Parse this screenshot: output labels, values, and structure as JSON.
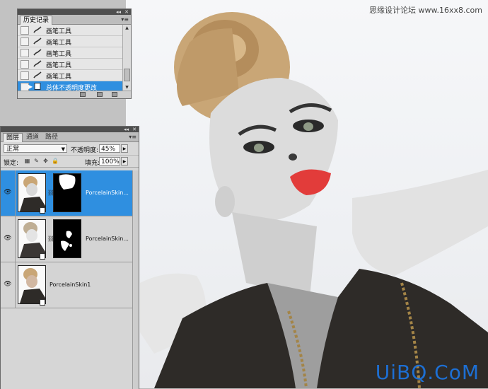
{
  "watermark_top": "思缘设计论坛",
  "watermark_top_site": "www.16xx8.com",
  "watermark_bottom": "UiBQ.CoM",
  "history": {
    "tab_label": "历史记录",
    "items": [
      {
        "label": "画笔工具"
      },
      {
        "label": "画笔工具"
      },
      {
        "label": "画笔工具"
      },
      {
        "label": "画笔工具"
      },
      {
        "label": "画笔工具"
      },
      {
        "label": "总体不透明度更改",
        "selected": true
      }
    ]
  },
  "layers_panel": {
    "tabs": [
      "图层",
      "通道",
      "路径"
    ],
    "blend_mode": "正常",
    "opacity_label": "不透明度:",
    "opacity_value": "45%",
    "lock_label": "锁定:",
    "fill_label": "填充:",
    "fill_value": "100%",
    "layers": [
      {
        "name": "PorcelainSkin...",
        "selected": true,
        "has_mask": true
      },
      {
        "name": "PorcelainSkin...",
        "selected": false,
        "has_mask": true
      },
      {
        "name": "PorcelainSkin1",
        "selected": false,
        "has_mask": false
      }
    ]
  },
  "colors": {
    "selection": "#2f8fe0",
    "brand_watermark": "#1d6fd3",
    "lips": "#e23c3a"
  }
}
